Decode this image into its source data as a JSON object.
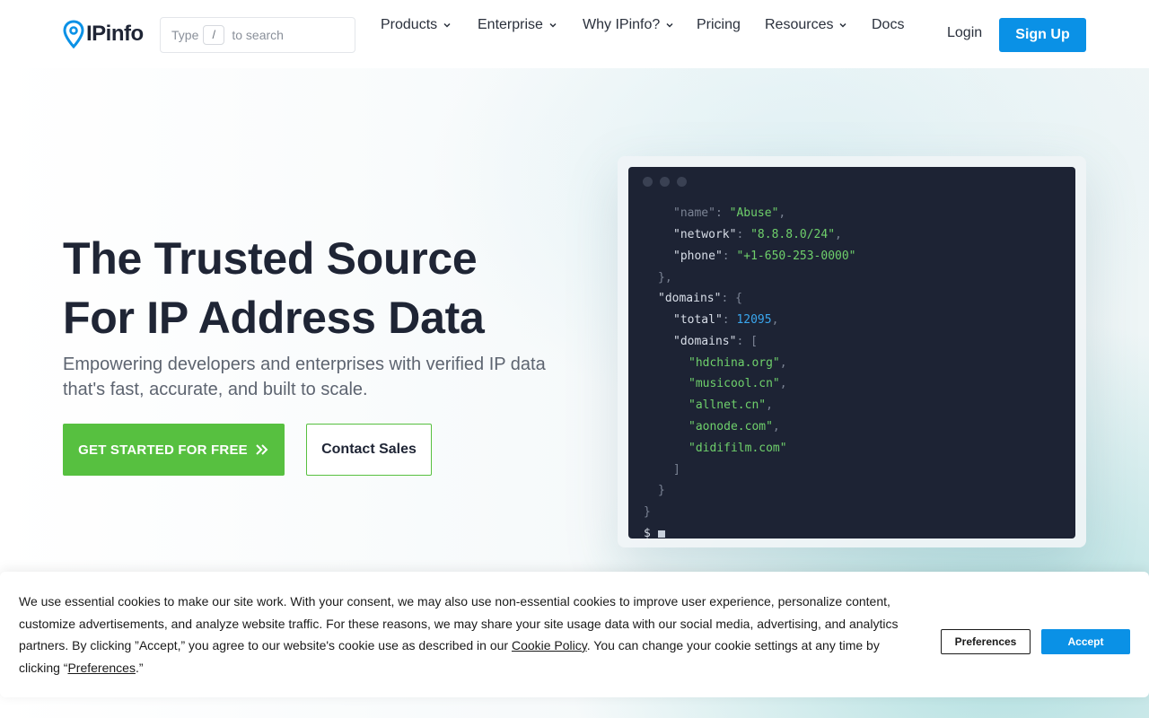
{
  "header": {
    "logo_text": "IPinfo",
    "search": {
      "prefix": "Type",
      "key": "/",
      "suffix": "to search"
    },
    "nav": [
      {
        "label": "Products",
        "has_dropdown": true
      },
      {
        "label": "Enterprise",
        "has_dropdown": true
      },
      {
        "label": "Why IPinfo?",
        "has_dropdown": true
      },
      {
        "label": "Pricing",
        "has_dropdown": false
      },
      {
        "label": "Resources",
        "has_dropdown": true
      },
      {
        "label": "Docs",
        "has_dropdown": false
      }
    ],
    "login": "Login",
    "signup": "Sign Up"
  },
  "hero": {
    "title_line1": "The Trusted Source",
    "title_line2": "For IP Address Data",
    "subtitle": "Empowering developers and enterprises with verified IP data that's fast, accurate, and built to scale.",
    "cta_primary": "GET STARTED FOR FREE",
    "cta_secondary": "Contact Sales"
  },
  "terminal": {
    "lines": [
      [
        {
          "t": "p",
          "v": "\"name\": "
        },
        {
          "t": "s",
          "v": "\"Abuse\""
        },
        {
          "t": "p",
          "v": ","
        }
      ],
      [
        {
          "t": "k",
          "v": "\"network\""
        },
        {
          "t": "p",
          "v": ": "
        },
        {
          "t": "s",
          "v": "\"8.8.8.0/24\""
        },
        {
          "t": "p",
          "v": ","
        }
      ],
      [
        {
          "t": "k",
          "v": "\"phone\""
        },
        {
          "t": "p",
          "v": ": "
        },
        {
          "t": "s",
          "v": "\"+1-650-253-0000\""
        }
      ],
      [
        {
          "t": "p",
          "v": "},"
        }
      ],
      [
        {
          "t": "k",
          "v": "\"domains\""
        },
        {
          "t": "p",
          "v": ": {"
        }
      ],
      [
        {
          "t": "k",
          "v": "\"total\""
        },
        {
          "t": "p",
          "v": ": "
        },
        {
          "t": "n",
          "v": "12095"
        },
        {
          "t": "p",
          "v": ","
        }
      ],
      [
        {
          "t": "k",
          "v": "\"domains\""
        },
        {
          "t": "p",
          "v": ": ["
        }
      ],
      [
        {
          "t": "s",
          "v": "\"hdchina.org\""
        },
        {
          "t": "p",
          "v": ","
        }
      ],
      [
        {
          "t": "s",
          "v": "\"musicool.cn\""
        },
        {
          "t": "p",
          "v": ","
        }
      ],
      [
        {
          "t": "s",
          "v": "\"allnet.cn\""
        },
        {
          "t": "p",
          "v": ","
        }
      ],
      [
        {
          "t": "s",
          "v": "\"aonode.com\""
        },
        {
          "t": "p",
          "v": ","
        }
      ],
      [
        {
          "t": "s",
          "v": "\"didifilm.com\""
        }
      ],
      [
        {
          "t": "p",
          "v": "]"
        }
      ],
      [
        {
          "t": "p",
          "v": "}"
        }
      ],
      [
        {
          "t": "p",
          "v": "}"
        }
      ],
      [
        {
          "t": "k",
          "v": "$"
        }
      ]
    ]
  },
  "cookie": {
    "text_before_link": "We use essential cookies to make our site work. With your consent, we may also use non-essential cookies to improve user experience, personalize content, customize advertisements, and analyze website traffic. For these reasons, we may share your site usage data with our social media, advertising, and analytics partners. By clicking ”Accept,” you agree to our website's cookie use as described in our ",
    "policy_link": "Cookie Policy",
    "text_middle": ". You can change your cookie settings at any time by clicking “",
    "preferences_link": "Preferences",
    "text_end": ".”",
    "preferences_button": "Preferences",
    "accept_button": "Accept"
  },
  "colors": {
    "brand_blue": "#0a91e6",
    "cta_green": "#57c040",
    "terminal_bg": "#1d2334",
    "string_green": "#6fd06b",
    "number_blue": "#3aa6ee"
  }
}
